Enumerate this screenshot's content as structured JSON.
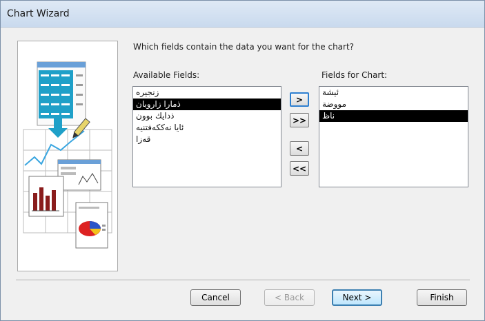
{
  "window": {
    "title": "Chart Wizard"
  },
  "prompt": "Which fields contain the data you want for the chart?",
  "available": {
    "label": "Available Fields:",
    "items": [
      "زنجیره",
      "ذمارا زاروبان",
      "ذدایك بوون",
      "ئایا نەککەفتنیە",
      "قەزا"
    ],
    "selected_index": 1
  },
  "chart_fields": {
    "label": "Fields for Chart:",
    "items": [
      "ئیشة",
      "مووضة",
      "ناظ"
    ],
    "selected_index": 2
  },
  "move_buttons": {
    "add_one": ">",
    "add_all": ">>",
    "remove_one": "<",
    "remove_all": "<<"
  },
  "buttons": {
    "cancel": "Cancel",
    "back": "< Back",
    "next": "Next >",
    "finish": "Finish"
  }
}
